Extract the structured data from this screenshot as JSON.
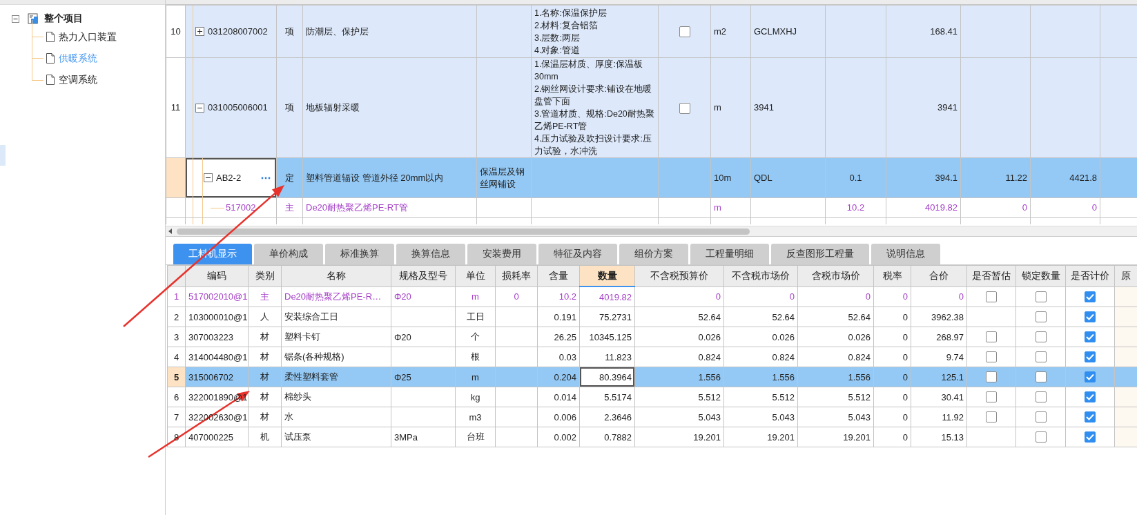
{
  "sidebar": {
    "tree": {
      "label": "整个项目",
      "expanded": true,
      "children": [
        {
          "label": "热力入口装置",
          "selected": false
        },
        {
          "label": "供暖系统",
          "selected": true
        },
        {
          "label": "空调系统",
          "selected": false
        }
      ]
    }
  },
  "upper_grid": {
    "rows": [
      {
        "number": "10",
        "kind": "item",
        "selected": false,
        "expanded": false,
        "code": "031208007002",
        "type": "项",
        "name": "防潮层、保护层",
        "description": [
          "1.名称:保温保护层",
          "2.材料:复合铝箔",
          "3.层数:两层",
          "4.对象:管道"
        ],
        "checked": false,
        "unit": "m2",
        "expression": "GCLMXHJ",
        "col_10": "168.41"
      },
      {
        "number": "11",
        "kind": "item",
        "selected": false,
        "expanded": true,
        "code": "031005006001",
        "type": "项",
        "name": "地板辐射采暖",
        "description": [
          "1.保温层材质、厚度:保温板30mm",
          "2.钢丝网设计要求:铺设在地暖盘管下面",
          "3.管道材质、规格:De20耐热聚乙烯PE-RT管",
          "4.压力试验及吹扫设计要求:压力试验，水冲洗"
        ],
        "checked": false,
        "unit": "m",
        "expression": "3941",
        "col_10": "3941",
        "children": [
          {
            "kind": "quota",
            "selected": true,
            "expanded": true,
            "code": "AB2-2",
            "type": "定",
            "name": "塑料管道辐设 管道外径 20mm以内",
            "col_5": "保温层及钢丝网铺设",
            "unit": "10m",
            "expression": "QDL",
            "col_9": "0.1",
            "col_10": "394.1",
            "col_11": "11.22",
            "col_12": "4421.8",
            "children": [
              {
                "kind": "material",
                "selected": false,
                "code": "517002",
                "type": "主",
                "name": "De20耐热聚乙烯PE-RT管",
                "unit": "m",
                "col_9": "10.2",
                "col_10": "4019.82",
                "col_11": "0",
                "col_12": "0"
              }
            ]
          }
        ]
      }
    ]
  },
  "tabs": [
    {
      "label": "工料机显示",
      "selected": true
    },
    {
      "label": "单价构成",
      "selected": false
    },
    {
      "label": "标准换算",
      "selected": false
    },
    {
      "label": "换算信息",
      "selected": false
    },
    {
      "label": "安装费用",
      "selected": false
    },
    {
      "label": "特征及内容",
      "selected": false
    },
    {
      "label": "组价方案",
      "selected": false
    },
    {
      "label": "工程量明细",
      "selected": false
    },
    {
      "label": "反查图形工程量",
      "selected": false
    },
    {
      "label": "说明信息",
      "selected": false
    }
  ],
  "lower_grid": {
    "columns": [
      {
        "label": "编码",
        "highlighted": false
      },
      {
        "label": "类别",
        "highlighted": false
      },
      {
        "label": "名称",
        "highlighted": false
      },
      {
        "label": "规格及型号",
        "highlighted": false
      },
      {
        "label": "单位",
        "highlighted": false
      },
      {
        "label": "损耗率",
        "highlighted": false
      },
      {
        "label": "含量",
        "highlighted": false
      },
      {
        "label": "数量",
        "highlighted": true
      },
      {
        "label": "不含税预算价",
        "highlighted": false
      },
      {
        "label": "不含税市场价",
        "highlighted": false
      },
      {
        "label": "含税市场价",
        "highlighted": false
      },
      {
        "label": "税率",
        "highlighted": false
      },
      {
        "label": "合价",
        "highlighted": false
      },
      {
        "label": "是否暂估",
        "highlighted": false
      },
      {
        "label": "锁定数量",
        "highlighted": false
      },
      {
        "label": "是否计价",
        "highlighted": false
      },
      {
        "label": "原",
        "highlighted": false
      }
    ],
    "rows": [
      {
        "number": "1",
        "kind": "main",
        "selected": false,
        "code": "517002010@1",
        "category": "主",
        "name": "De20耐热聚乙烯PE-R…",
        "spec": "Φ20",
        "unit": "m",
        "loss_rate": "0",
        "content": "10.2",
        "quantity": "4019.82",
        "budget_price": "0",
        "market_price": "0",
        "tax_market_price": "0",
        "tax_rate": "0",
        "total": "0",
        "estimated": false,
        "locked": false,
        "priced": true
      },
      {
        "number": "2",
        "kind": "normal",
        "selected": false,
        "code": "103000010@1",
        "category": "人",
        "name": "安装综合工日",
        "unit": "工日",
        "content": "0.191",
        "quantity": "75.2731",
        "budget_price": "52.64",
        "market_price": "52.64",
        "tax_market_price": "52.64",
        "tax_rate": "0",
        "total": "3962.38",
        "locked": false,
        "priced": true
      },
      {
        "number": "3",
        "kind": "normal",
        "selected": false,
        "code": "307003223",
        "category": "材",
        "name": "塑料卡钉",
        "spec": "Φ20",
        "unit": "个",
        "content": "26.25",
        "quantity": "10345.125",
        "budget_price": "0.026",
        "market_price": "0.026",
        "tax_market_price": "0.026",
        "tax_rate": "0",
        "total": "268.97",
        "estimated": false,
        "locked": false,
        "priced": true
      },
      {
        "number": "4",
        "kind": "normal",
        "selected": false,
        "code": "314004480@1",
        "category": "材",
        "name": "锯条(各种规格)",
        "unit": "根",
        "content": "0.03",
        "quantity": "11.823",
        "budget_price": "0.824",
        "market_price": "0.824",
        "tax_market_price": "0.824",
        "tax_rate": "0",
        "total": "9.74",
        "estimated": false,
        "locked": false,
        "priced": true
      },
      {
        "number": "5",
        "kind": "normal",
        "selected": true,
        "code": "315006702",
        "category": "材",
        "name": "柔性塑料套管",
        "spec": "Φ25",
        "unit": "m",
        "content": "0.204",
        "quantity": "80.3964",
        "budget_price": "1.556",
        "market_price": "1.556",
        "tax_market_price": "1.556",
        "tax_rate": "0",
        "total": "125.1",
        "estimated": false,
        "locked": false,
        "priced": true
      },
      {
        "number": "6",
        "kind": "normal",
        "selected": false,
        "code": "322001890@1",
        "category": "材",
        "name": "棉纱头",
        "unit": "kg",
        "content": "0.014",
        "quantity": "5.5174",
        "budget_price": "5.512",
        "market_price": "5.512",
        "tax_market_price": "5.512",
        "tax_rate": "0",
        "total": "30.41",
        "estimated": false,
        "locked": false,
        "priced": true
      },
      {
        "number": "7",
        "kind": "normal",
        "selected": false,
        "code": "322002630@1",
        "category": "材",
        "name": "水",
        "unit": "m3",
        "content": "0.006",
        "quantity": "2.3646",
        "budget_price": "5.043",
        "market_price": "5.043",
        "tax_market_price": "5.043",
        "tax_rate": "0",
        "total": "11.92",
        "estimated": false,
        "locked": false,
        "priced": true
      },
      {
        "number": "8",
        "kind": "normal",
        "selected": false,
        "code": "407000225",
        "category": "机",
        "name": "试压泵",
        "spec": "3MPa",
        "unit": "台班",
        "content": "0.002",
        "quantity": "0.7882",
        "budget_price": "19.201",
        "market_price": "19.201",
        "tax_market_price": "19.201",
        "tax_rate": "0",
        "total": "15.13",
        "locked": false,
        "priced": true
      }
    ]
  }
}
